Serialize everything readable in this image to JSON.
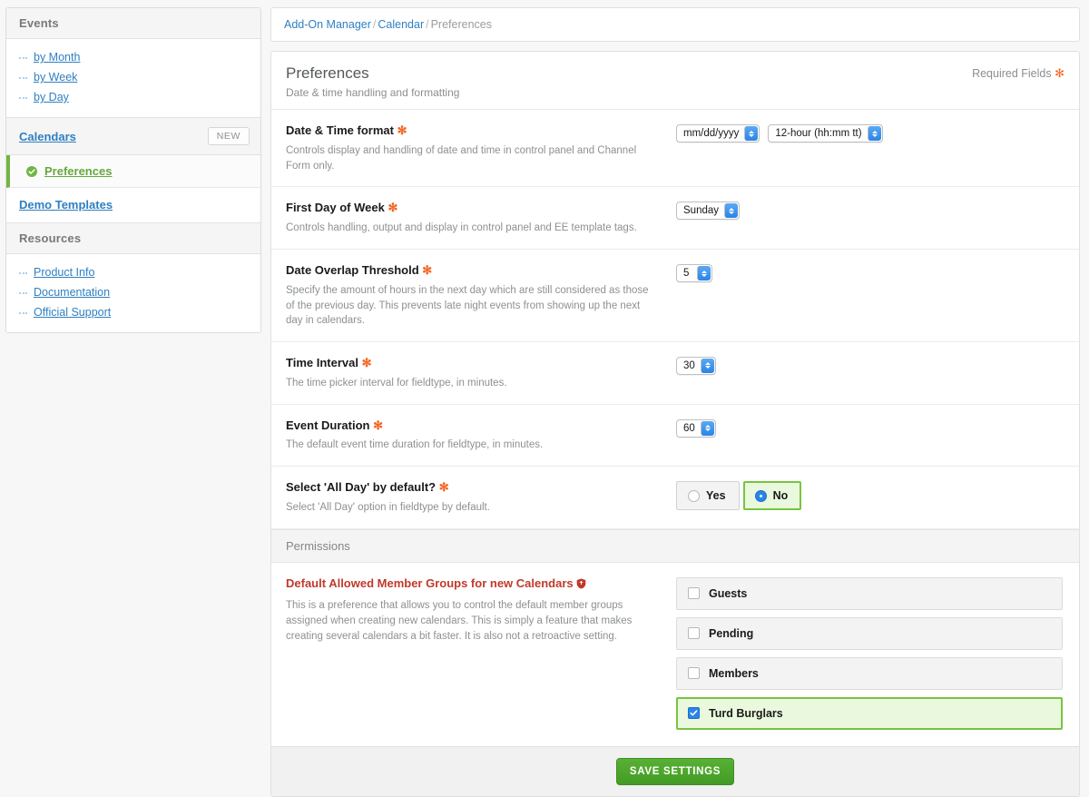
{
  "sidebar": {
    "events_header": "Events",
    "event_links": [
      {
        "label": "by Month"
      },
      {
        "label": "by Week"
      },
      {
        "label": "by Day"
      }
    ],
    "calendars": {
      "label": "Calendars",
      "badge": "NEW"
    },
    "preferences": {
      "label": "Preferences"
    },
    "demo_templates": {
      "label": "Demo Templates"
    },
    "resources_header": "Resources",
    "resource_links": [
      {
        "label": "Product Info"
      },
      {
        "label": "Documentation"
      },
      {
        "label": "Official Support"
      }
    ]
  },
  "breadcrumb": {
    "item1": "Add-On Manager",
    "sep1": "/",
    "item2": "Calendar",
    "sep2": "/",
    "item3": "Preferences"
  },
  "panel": {
    "title": "Preferences",
    "subtitle": "Date & time handling and formatting",
    "required_note": "Required Fields",
    "required_marker": "✻"
  },
  "fields": [
    {
      "label": "Date & Time format",
      "required": "✻",
      "desc": "Controls display and handling of date and time in control panel and Channel Form only.",
      "controls": [
        {
          "type": "select",
          "value": "mm/dd/yyyy"
        },
        {
          "type": "select",
          "value": "12-hour (hh:mm tt)"
        }
      ]
    },
    {
      "label": "First Day of Week",
      "required": "✻",
      "desc": "Controls handling, output and display in control panel and EE template tags.",
      "controls": [
        {
          "type": "select",
          "value": "Sunday"
        }
      ]
    },
    {
      "label": "Date Overlap Threshold",
      "required": "✻",
      "desc": "Specify the amount of hours in the next day which are still considered as those of the previous day. This prevents late night events from showing up the next day in calendars.",
      "controls": [
        {
          "type": "number",
          "value": "5"
        }
      ]
    },
    {
      "label": "Time Interval",
      "required": "✻",
      "desc": "The time picker interval for fieldtype, in minutes.",
      "controls": [
        {
          "type": "number",
          "value": "30"
        }
      ]
    },
    {
      "label": "Event Duration",
      "required": "✻",
      "desc": "The default event time duration for fieldtype, in minutes.",
      "controls": [
        {
          "type": "number",
          "value": "60"
        }
      ]
    }
  ],
  "all_day": {
    "label": "Select 'All Day' by default?",
    "required": "✻",
    "desc": "Select 'All Day' option in fieldtype by default.",
    "options": [
      {
        "label": "Yes",
        "selected": false
      },
      {
        "label": "No",
        "selected": true
      }
    ]
  },
  "permissions": {
    "section_label": "Permissions",
    "label": "Default Allowed Member Groups for new Calendars",
    "desc": "This is a preference that allows you to control the default member groups assigned when creating new calendars. This is simply a feature that makes creating several calendars a bit faster. It is also not a retroactive setting.",
    "groups": [
      {
        "label": "Guests",
        "checked": false
      },
      {
        "label": "Pending",
        "checked": false
      },
      {
        "label": "Members",
        "checked": false
      },
      {
        "label": "Turd Burglars",
        "checked": true
      }
    ]
  },
  "footer": {
    "save_label": "SAVE SETTINGS"
  },
  "colors": {
    "accent_green": "#72b544",
    "link_blue": "#2f7fc1",
    "required_orange": "#f26522",
    "permission_red": "#c0392b",
    "select_blue": "#2a84e8"
  }
}
